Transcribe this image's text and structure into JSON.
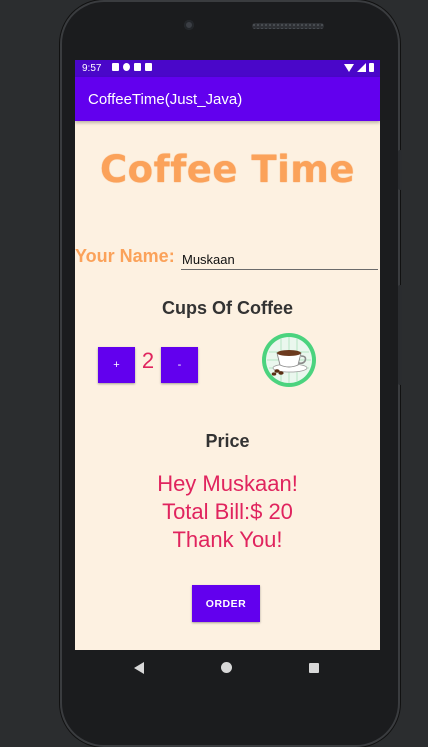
{
  "status_bar": {
    "time": "9:57",
    "left_icons": [
      "notification-icon",
      "sync-icon",
      "sd-card-icon",
      "storage-icon"
    ],
    "right_icons": [
      "wifi-icon",
      "signal-icon",
      "battery-icon"
    ]
  },
  "app_bar": {
    "title": "CoffeeTime(Just_Java)",
    "color": "#6200ee"
  },
  "main": {
    "hero_title": "Coffee Time",
    "name_label": "Your Name:",
    "name_value": "Muskaan",
    "cups_title": "Cups Of Coffee",
    "plus_label": "+",
    "minus_label": "-",
    "quantity": "2",
    "coffee_icon": "coffee-cup-icon",
    "price_title": "Price",
    "summary_line1": "Hey Muskaan!",
    "summary_line2": "Total Bill:$ 20",
    "summary_line3": "Thank You!",
    "order_label": "ORDER"
  },
  "nav_bar": {
    "icons": [
      "back-icon",
      "home-icon",
      "recents-icon"
    ]
  },
  "colors": {
    "accent": "#6200ee",
    "hero": "#fba25a",
    "summary": "#e0245e",
    "background": "#fdf1e1"
  }
}
